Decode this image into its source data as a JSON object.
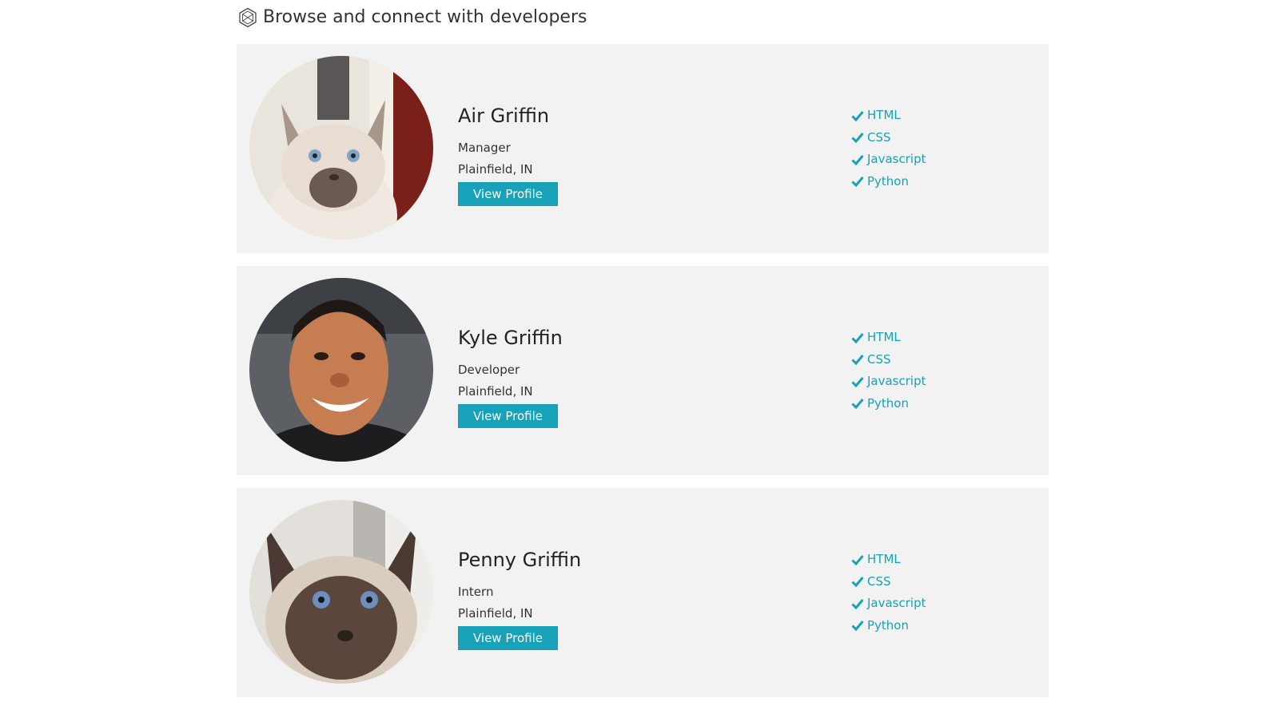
{
  "header": {
    "title": "Browse and connect with developers",
    "icon": "hexagon-logo-icon"
  },
  "colors": {
    "accent": "#17a2b8",
    "card_background": "#f2f2f2"
  },
  "profiles": [
    {
      "name": "Air Griffin",
      "role": "Manager",
      "location": "Plainfield, IN",
      "button_label": "View Profile",
      "skills": [
        "HTML",
        "CSS",
        "Javascript",
        "Python"
      ]
    },
    {
      "name": "Kyle Griffin",
      "role": "Developer",
      "location": "Plainfield, IN",
      "button_label": "View Profile",
      "skills": [
        "HTML",
        "CSS",
        "Javascript",
        "Python"
      ]
    },
    {
      "name": "Penny Griffin",
      "role": "Intern",
      "location": "Plainfield, IN",
      "button_label": "View Profile",
      "skills": [
        "HTML",
        "CSS",
        "Javascript",
        "Python"
      ]
    }
  ]
}
